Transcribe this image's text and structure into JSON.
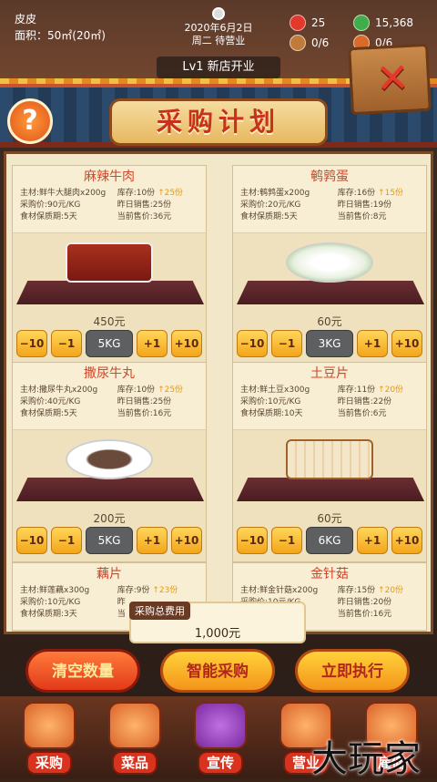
{
  "hud": {
    "player_name": "皮皮",
    "area": "面积：50㎡(20㎡)",
    "date": "2020年6月2日",
    "weekday_status": "周二 待营业",
    "hearts": "25",
    "money": "15,368",
    "staff_a": "0/6",
    "staff_b": "0/6",
    "level": "Lv1 新店开业"
  },
  "help_label": "?",
  "title": "采购计划",
  "close_label": "✕",
  "items": [
    {
      "name": "麻辣牛肉",
      "main": "主材:鲜牛大腿肉x200g",
      "price_per": "采购价:90元/KG",
      "shelf_life": "食材保质期:5天",
      "stock": "库存:10份",
      "stock_up": "↑25份",
      "yesterday": "昨日销售:25份",
      "current": "当前售价:36元",
      "cost": "450元",
      "qty": "5KG"
    },
    {
      "name": "鹌鹑蛋",
      "main": "主材:鹌鹑蛋x200g",
      "price_per": "采购价:20元/KG",
      "shelf_life": "食材保质期:5天",
      "stock": "库存:16份",
      "stock_up": "↑15份",
      "yesterday": "昨日销售:19份",
      "current": "当前售价:8元",
      "cost": "60元",
      "qty": "3KG"
    },
    {
      "name": "撒尿牛丸",
      "main": "主材:撒尿牛丸x200g",
      "price_per": "采购价:40元/KG",
      "shelf_life": "食材保质期:5天",
      "stock": "库存:10份",
      "stock_up": "↑25份",
      "yesterday": "昨日销售:25份",
      "current": "当前售价:16元",
      "cost": "200元",
      "qty": "5KG"
    },
    {
      "name": "土豆片",
      "main": "主材:鲜土豆x300g",
      "price_per": "采购价:10元/KG",
      "shelf_life": "食材保质期:10天",
      "stock": "库存:11份",
      "stock_up": "↑20份",
      "yesterday": "昨日销售:22份",
      "current": "当前售价:6元",
      "cost": "60元",
      "qty": "6KG"
    },
    {
      "name": "藕片",
      "main": "主材:鲜莲藕x300g",
      "price_per": "采购价:10元/KG",
      "shelf_life": "食材保质期:3天",
      "stock": "库存:9份",
      "stock_up": "↑23份",
      "yesterday": "昨",
      "current": "当"
    },
    {
      "name": "金针菇",
      "main": "主材:鲜金针菇x200g",
      "price_per": "采购价:10元/KG",
      "shelf_life": "食材保质期:3天",
      "stock": "库存:15份",
      "stock_up": "↑20份",
      "yesterday": "昨日销售:20份",
      "current": "当前售价:16元"
    }
  ],
  "qty_buttons": {
    "minus10": "−10",
    "minus1": "−1",
    "plus1": "+1",
    "plus10": "+10"
  },
  "total": {
    "label": "采购总费用",
    "value": "1,000元"
  },
  "actions": {
    "clear": "清空数量",
    "smart": "智能采购",
    "execute": "立即执行"
  },
  "nav": [
    "采购",
    "菜品",
    "宣传",
    "营业",
    "雇佣"
  ],
  "watermark": "大玩家",
  "colors": {
    "accent": "#d2462a",
    "button": "#f3a51a",
    "board": "#f3e7c9"
  }
}
